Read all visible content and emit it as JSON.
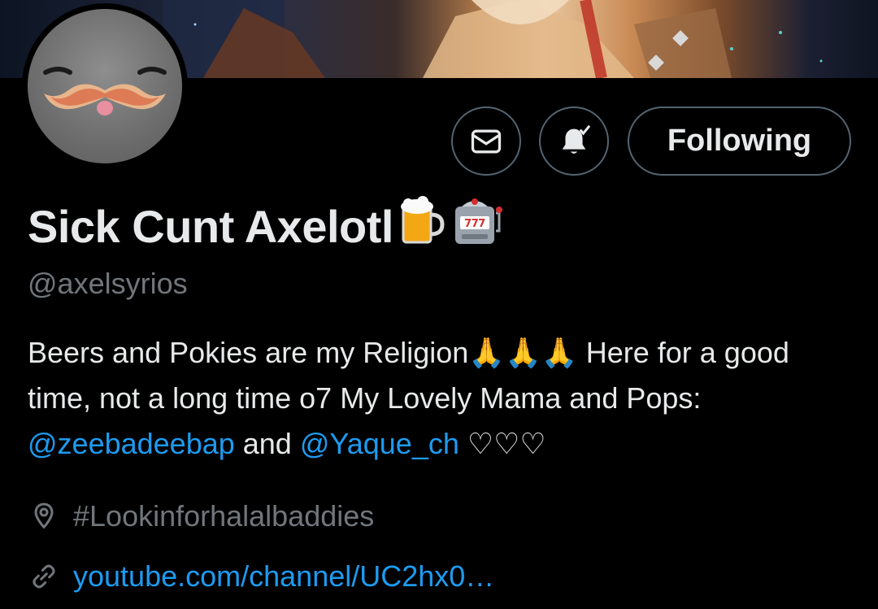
{
  "profile": {
    "display_name": "Sick Cunt Axelotl",
    "name_emojis": [
      "beer-mug",
      "slot-machine"
    ],
    "handle": "@axelsyrios",
    "bio": {
      "text_before": "Beers and Pokies are my Religion🙏🙏🙏  Here for a good time, not a long time o7  My Lovely Mama and Pops: ",
      "mention_1": "@zeebadeebap",
      "middle": " and ",
      "mention_2": "@Yaque_ch",
      "text_after": " ♡♡♡"
    },
    "location": "#Lookinforhalalbaddies",
    "website": "youtube.com/channel/UC2hx0…"
  },
  "actions": {
    "message_icon": "envelope-icon",
    "notification_icon": "bell-check-icon",
    "follow_label": "Following"
  },
  "colors": {
    "background": "#000000",
    "text": "#e7e9ea",
    "secondary": "#71767b",
    "link": "#1d9bf0",
    "button_border": "#536471"
  }
}
